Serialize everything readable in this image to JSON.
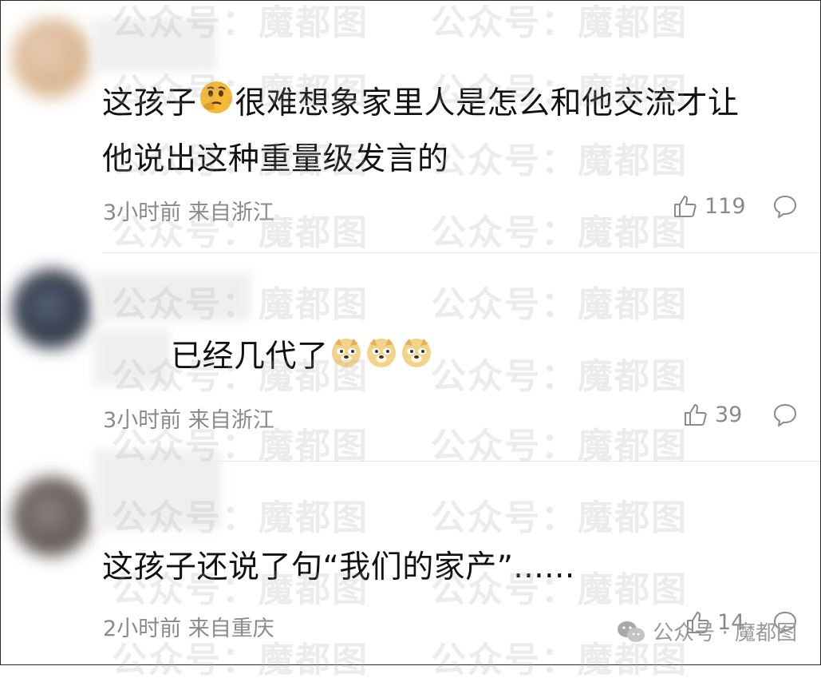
{
  "comments": [
    {
      "text_lines": [
        "这孩子",
        "很难想象家里人是怎么和他交流才让",
        "他说出这种重量级发言的"
      ],
      "meta": "3小时前 来自浙江",
      "likes": "119"
    },
    {
      "text": "已经几代了",
      "meta": "3小时前 来自浙江",
      "likes": "39"
    },
    {
      "text": "这孩子还说了句“我们的家产”......",
      "meta": "2小时前 来自重庆",
      "likes": "14"
    }
  ],
  "watermark": {
    "text": "公众号：魔都图"
  },
  "brand": {
    "label": "公众号 · 魔都图"
  }
}
